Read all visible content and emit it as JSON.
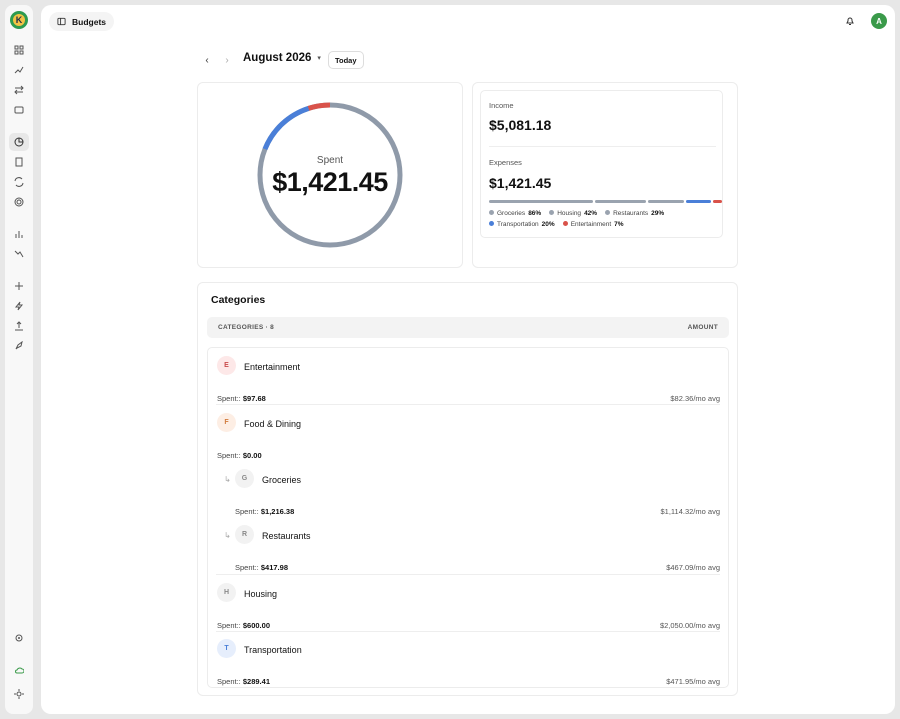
{
  "app": {
    "logo_letter": "K"
  },
  "header": {
    "breadcrumb": "Budgets",
    "avatar_initial": "A"
  },
  "nav": {
    "month_label": "August 2026",
    "today_label": "Today"
  },
  "summary": {
    "spent_label": "Spent",
    "spent_value": "$1,421.45",
    "income_label": "Income",
    "income_value": "$5,081.18",
    "expenses_label": "Expenses",
    "expenses_value": "$1,421.45",
    "donut_segments": [
      {
        "name": "Transportation",
        "color": "#4a7fd8",
        "fraction": 0.14
      },
      {
        "name": "Entertainment",
        "color": "#d9524a",
        "fraction": 0.05
      }
    ],
    "donut_track_color": "#8f9aa9",
    "legend": [
      {
        "name": "Groceries",
        "pct": "86%",
        "color": "#9aa3af"
      },
      {
        "name": "Housing",
        "pct": "42%",
        "color": "#9aa3af"
      },
      {
        "name": "Restaurants",
        "pct": "29%",
        "color": "#9aa3af"
      },
      {
        "name": "Transportation",
        "pct": "20%",
        "color": "#4a7fd8"
      },
      {
        "name": "Entertainment",
        "pct": "7%",
        "color": "#d9524a"
      }
    ],
    "bar_segments": [
      {
        "color": "#9aa3af",
        "fraction": 0.46
      },
      {
        "color": "#9aa3af",
        "fraction": 0.23
      },
      {
        "color": "#9aa3af",
        "fraction": 0.16
      },
      {
        "color": "#4a7fd8",
        "fraction": 0.11
      },
      {
        "color": "#d9524a",
        "fraction": 0.04
      }
    ]
  },
  "categories": {
    "title": "Categories",
    "header_left": "CATEGORIES · 8",
    "header_right": "AMOUNT",
    "spent_prefix": "Spent::",
    "rows": [
      {
        "initial": "E",
        "name": "Entertainment",
        "spent": "$97.68",
        "avg": "$82.36/mo avg",
        "badge_bg": "#fde8e8",
        "badge_fg": "#c94a4a"
      },
      {
        "initial": "F",
        "name": "Food & Dining",
        "spent": "$0.00",
        "avg": "",
        "badge_bg": "#fdeee4",
        "badge_fg": "#d07a3a"
      },
      {
        "initial": "G",
        "name": "Groceries",
        "spent": "$1,216.38",
        "avg": "$1,114.32/mo avg",
        "badge_bg": "#f2f2f2",
        "badge_fg": "#888",
        "child": true
      },
      {
        "initial": "R",
        "name": "Restaurants",
        "spent": "$417.98",
        "avg": "$467.09/mo avg",
        "badge_bg": "#f2f2f2",
        "badge_fg": "#888",
        "child": true
      },
      {
        "initial": "H",
        "name": "Housing",
        "spent": "$600.00",
        "avg": "$2,050.00/mo avg",
        "badge_bg": "#f2f2f2",
        "badge_fg": "#888"
      },
      {
        "initial": "T",
        "name": "Transportation",
        "spent": "$289.41",
        "avg": "$471.95/mo avg",
        "badge_bg": "#e6eefc",
        "badge_fg": "#4a7fd8"
      }
    ]
  }
}
